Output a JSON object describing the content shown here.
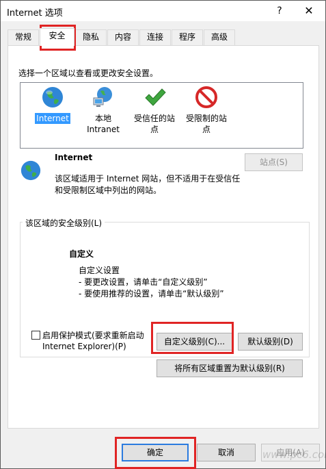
{
  "window": {
    "title": "Internet 选项",
    "help": "?",
    "close": "✕"
  },
  "tabs": [
    "常规",
    "安全",
    "隐私",
    "内容",
    "连接",
    "程序",
    "高级"
  ],
  "security": {
    "instruction": "选择一个区域以查看或更改安全设置。",
    "zones": [
      {
        "line1": "Internet",
        "line2": ""
      },
      {
        "line1": "本地",
        "line2": "Intranet"
      },
      {
        "line1": "受信任的站",
        "line2": "点"
      },
      {
        "line1": "受限制的站",
        "line2": "点"
      }
    ],
    "zone_name": "Internet",
    "zone_desc1": "该区域适用于 Internet 网站，但不适用于在受信任",
    "zone_desc2": "和受限制区域中列出的网站。",
    "sites_button": "站点(S)",
    "level_group_title": "该区域的安全级别(L)",
    "level_name": "自定义",
    "level_line1": "自定义设置",
    "level_line2": "- 要更改设置，请单击“自定义级别”",
    "level_line3": "- 要使用推荐的设置，请单击“默认级别”",
    "protected_mode_line1": "启用保护模式(要求重新启动",
    "protected_mode_line2": "Internet Explorer)(P)",
    "custom_level_button": "自定义级别(C)...",
    "default_level_button": "默认级别(D)",
    "reset_all_button": "将所有区域重置为默认级别(R)"
  },
  "footer": {
    "ok": "确定",
    "cancel": "取消",
    "apply": "应用(A)"
  },
  "watermark": "www.pc6.com"
}
